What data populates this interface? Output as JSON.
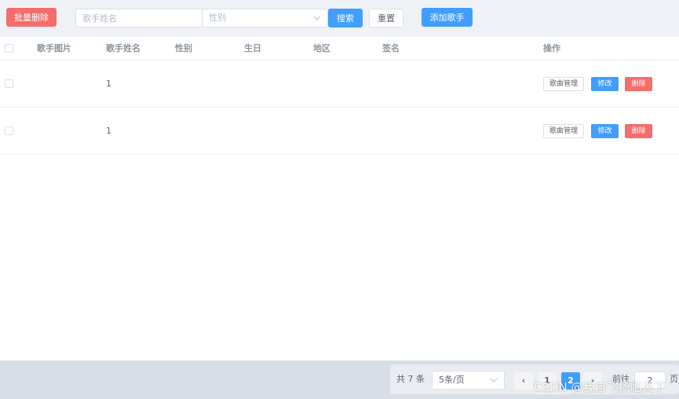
{
  "toolbar": {
    "batch_delete_label": "批量删除",
    "search_name_placeholder": "歌手姓名",
    "gender_placeholder": "性别",
    "search_label": "搜索",
    "reset_label": "重置",
    "add_singer_label": "添加歌手"
  },
  "table": {
    "headers": {
      "pic": "歌手图片",
      "name": "歌手姓名",
      "sex": "性别",
      "birth": "生日",
      "location": "地区",
      "intro": "签名",
      "actions": "操作"
    },
    "rows": [
      {
        "name": "1",
        "song_btn": "歌曲管理",
        "edit_btn": "修改",
        "delete_btn": "删除"
      },
      {
        "name": "1",
        "song_btn": "歌曲管理",
        "edit_btn": "修改",
        "delete_btn": "删除"
      }
    ]
  },
  "pagination": {
    "total": "共 7 条",
    "page_size": "5条/页",
    "prev_icon": "‹",
    "pages": [
      "1",
      "2"
    ],
    "next_icon": "›",
    "goto_label": "前往",
    "goto_value": "2",
    "goto_suffix": "页"
  },
  "watermark": "CSDN @我自飞扬临天下",
  "colors": {
    "primary": "#409eff",
    "danger": "#f56c6c",
    "background": "#eef1f6"
  }
}
